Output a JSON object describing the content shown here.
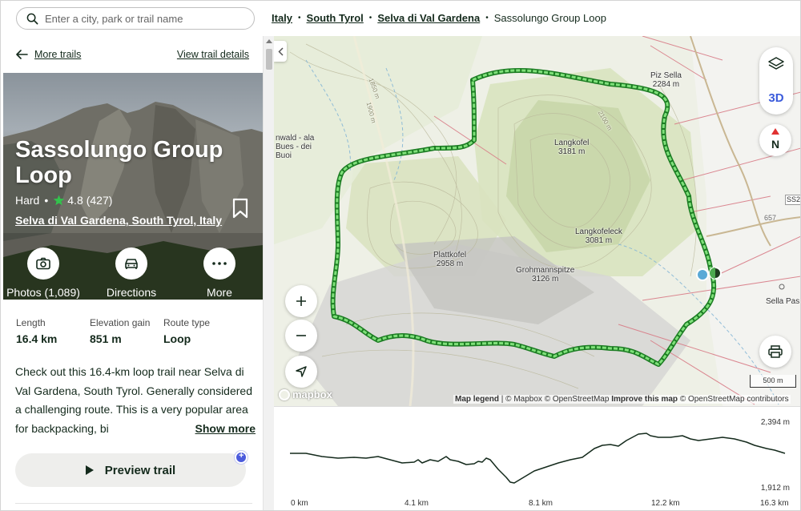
{
  "search": {
    "placeholder": "Enter a city, park or trail name"
  },
  "breadcrumbs": {
    "items": [
      "Italy",
      "South Tyrol",
      "Selva di Val Gardena"
    ],
    "current": "Sassolungo Group Loop"
  },
  "panel": {
    "back_label": "More trails",
    "details_label": "View trail details",
    "title": "Sassolungo Group Loop",
    "difficulty": "Hard",
    "rating": "4.8",
    "review_count": "(427)",
    "location": "Selva di Val Gardena, South Tyrol, Italy",
    "actions": {
      "photos": "Photos (1,089)",
      "directions": "Directions",
      "more": "More"
    },
    "stats": [
      {
        "label": "Length",
        "value": "16.4 km"
      },
      {
        "label": "Elevation gain",
        "value": "851 m"
      },
      {
        "label": "Route type",
        "value": "Loop"
      }
    ],
    "description": "Check out this 16.4-km loop trail near Selva di Val Gardena, South Tyrol. Generally considered a challenging route. This is a very popular area for backpacking, bi",
    "show_more": "Show more",
    "preview_label": "Preview trail"
  },
  "map": {
    "button_3d": "3D",
    "compass_label": "N",
    "labels": {
      "piz_sella": "Piz Sella",
      "piz_sella_elev": "2284 m",
      "langkofel": "Langkofel",
      "langkofel_elev": "3181 m",
      "langkofeleck": "Langkofeleck",
      "langkofeleck_elev": "3081 m",
      "plattkofel": "Plattkofel",
      "plattkofel_elev": "2958 m",
      "grohmann": "Grohmannspitze",
      "grohmann_elev": "3126 m",
      "west_place": "nwald - ala Bues - dei Buoi",
      "sella_pass": "Sella Pas",
      "road_ss": "SS2",
      "road_657": "657",
      "contour_1": "1850 m",
      "contour_2": "1900 m",
      "contour_3": "2100 m"
    },
    "scale": "500 m",
    "logo": "mapbox",
    "attribution": {
      "legend": "Map legend",
      "mapbox": "© Mapbox",
      "osm": "© OpenStreetMap",
      "improve": "Improve this map",
      "osm_contrib": "© OpenStreetMap contributors"
    },
    "trail_color": "#3dbd3a"
  },
  "elevation": {
    "y_max": "2,394 m",
    "y_min": "1,912 m",
    "x_ticks": [
      "0 km",
      "4.1 km",
      "8.1 km",
      "12.2 km",
      "16.3 km"
    ]
  }
}
